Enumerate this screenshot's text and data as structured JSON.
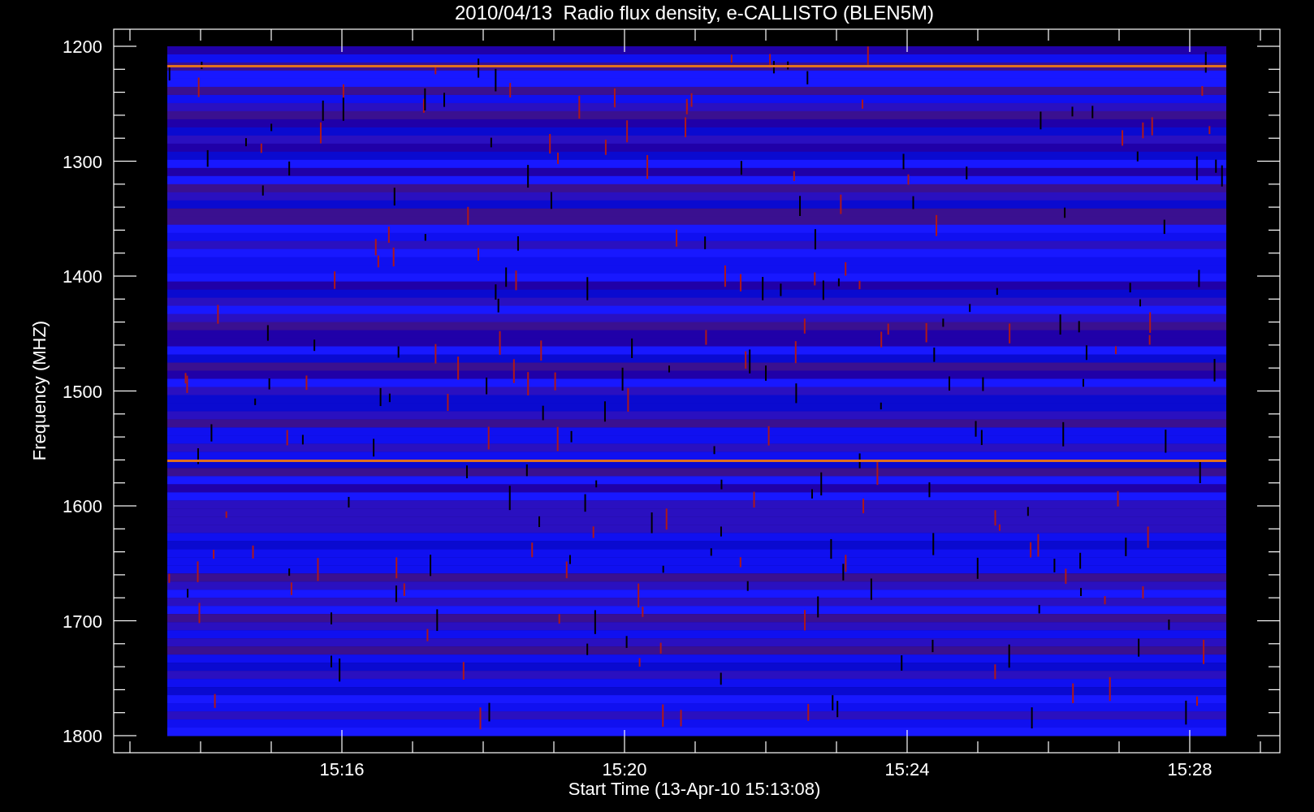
{
  "title": "2010/04/13  Radio flux density, e-CALLISTO (BLEN5M)",
  "y_axis": {
    "label": "Frequency (MHZ)",
    "ticks": [
      "1200",
      "1300",
      "1400",
      "1500",
      "1600",
      "1700",
      "1800"
    ]
  },
  "x_axis": {
    "label": "Start Time (13-Apr-10 15:13:08)",
    "ticks": [
      "15:16",
      "15:20",
      "15:24",
      "15:28"
    ]
  }
}
